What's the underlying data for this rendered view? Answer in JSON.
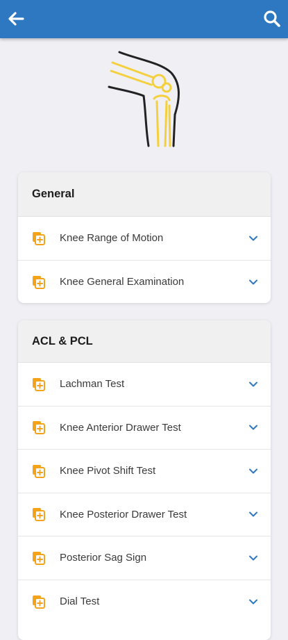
{
  "colors": {
    "app_bar": "#2d78c0",
    "accent": "#2d78c0",
    "icon_orange": "#f5a31a",
    "illustration_yellow": "#f4d03f",
    "background": "#efeff4"
  },
  "app_bar": {
    "back_icon": "arrow-left-icon",
    "search_icon": "search-icon"
  },
  "hero": {
    "icon": "knee-joint-illustration"
  },
  "sections": [
    {
      "title": "General",
      "items": [
        {
          "label": "Knee Range of Motion"
        },
        {
          "label": "Knee General Examination"
        }
      ]
    },
    {
      "title": "ACL & PCL",
      "items": [
        {
          "label": "Lachman Test"
        },
        {
          "label": "Knee Anterior Drawer Test"
        },
        {
          "label": "Knee Pivot Shift Test"
        },
        {
          "label": "Knee Posterior Drawer Test"
        },
        {
          "label": "Posterior Sag Sign"
        },
        {
          "label": "Dial Test"
        }
      ]
    }
  ]
}
